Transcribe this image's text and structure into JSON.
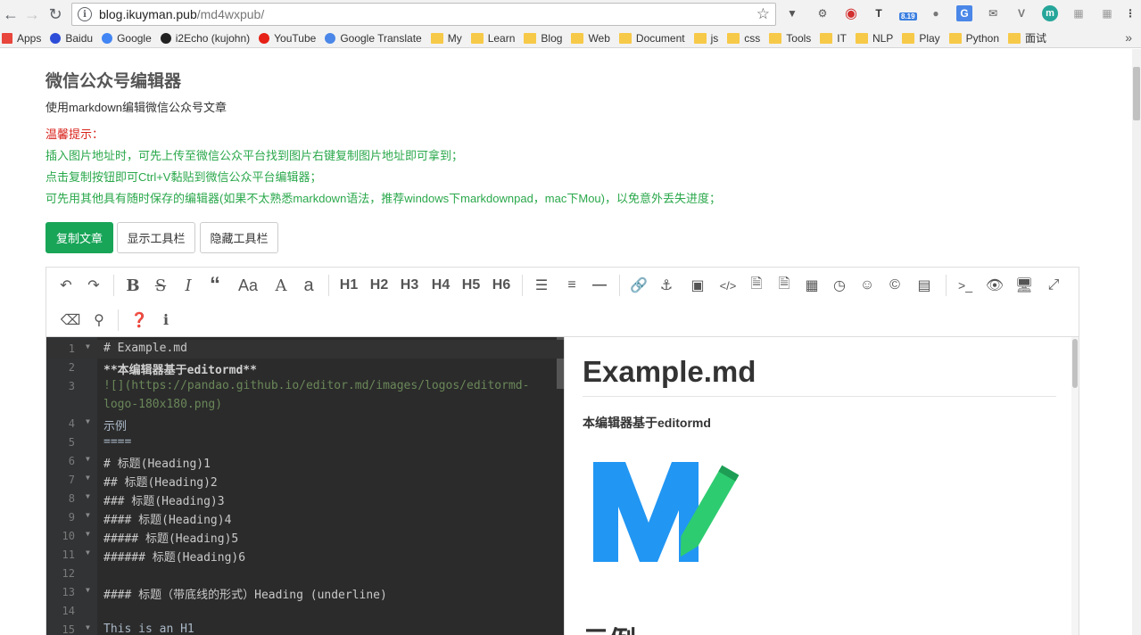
{
  "browser": {
    "url_host": "blog.ikuyman.pub",
    "url_path": "/md4wxpub/",
    "ext_badge": "8.19",
    "bookmarks": [
      {
        "label": "Apps",
        "type": "apps"
      },
      {
        "label": "Baidu",
        "type": "site"
      },
      {
        "label": "Google",
        "type": "site"
      },
      {
        "label": "i2Echo (kujohn)",
        "type": "site"
      },
      {
        "label": "YouTube",
        "type": "site"
      },
      {
        "label": "Google Translate",
        "type": "site"
      },
      {
        "label": "My",
        "type": "folder"
      },
      {
        "label": "Learn",
        "type": "folder"
      },
      {
        "label": "Blog",
        "type": "folder"
      },
      {
        "label": "Web",
        "type": "folder"
      },
      {
        "label": "Document",
        "type": "folder"
      },
      {
        "label": "js",
        "type": "folder"
      },
      {
        "label": "css",
        "type": "folder"
      },
      {
        "label": "Tools",
        "type": "folder"
      },
      {
        "label": "IT",
        "type": "folder"
      },
      {
        "label": "NLP",
        "type": "folder"
      },
      {
        "label": "Play",
        "type": "folder"
      },
      {
        "label": "Python",
        "type": "folder"
      },
      {
        "label": "面试",
        "type": "folder"
      }
    ],
    "more": "»"
  },
  "page": {
    "title": "微信公众号编辑器",
    "subtitle": "使用markdown编辑微信公众号文章",
    "tip_head": "温馨提示：",
    "tips": [
      "插入图片地址时，可先上传至微信公众平台找到图片右键复制图片地址即可拿到；",
      "点击复制按钮即可Ctrl+V黏贴到微信公众平台编辑器；",
      "可先用其他具有随时保存的编辑器(如果不太熟悉markdown语法，推荐windows下markdownpad，mac下Mou)，以免意外丢失进度；"
    ],
    "buttons": {
      "copy": "复制文章",
      "show_toolbar": "显示工具栏",
      "hide_toolbar": "隐藏工具栏"
    }
  },
  "toolbar": {
    "headings": [
      "H1",
      "H2",
      "H3",
      "H4",
      "H5",
      "H6"
    ],
    "aa_upper": "Aa",
    "a_upper": "A",
    "a_lower": "a"
  },
  "code": {
    "lines": [
      {
        "n": "1",
        "fold": true,
        "text": "# Example.md"
      },
      {
        "n": "2",
        "fold": false,
        "text": "**本编辑器基于editormd**"
      },
      {
        "n": "3",
        "fold": false,
        "text": "![](https://pandao.github.io/editor.md/images/logos/editormd-"
      },
      {
        "n": "",
        "fold": false,
        "text": "logo-180x180.png)"
      },
      {
        "n": "4",
        "fold": true,
        "text": "示例"
      },
      {
        "n": "5",
        "fold": false,
        "text": "===="
      },
      {
        "n": "6",
        "fold": true,
        "text": "# 标题(Heading)1"
      },
      {
        "n": "7",
        "fold": true,
        "text": "## 标题(Heading)2"
      },
      {
        "n": "8",
        "fold": true,
        "text": "### 标题(Heading)3"
      },
      {
        "n": "9",
        "fold": true,
        "text": "#### 标题(Heading)4"
      },
      {
        "n": "10",
        "fold": true,
        "text": "##### 标题(Heading)5"
      },
      {
        "n": "11",
        "fold": true,
        "text": "###### 标题(Heading)6"
      },
      {
        "n": "12",
        "fold": false,
        "text": ""
      },
      {
        "n": "13",
        "fold": true,
        "text": "#### 标题（带底线的形式）Heading (underline)"
      },
      {
        "n": "14",
        "fold": false,
        "text": ""
      },
      {
        "n": "15",
        "fold": true,
        "text": "This is an H1"
      }
    ]
  },
  "preview": {
    "h1": "Example.md",
    "bold": "本编辑器基于editormd",
    "h2": "示例",
    "logo_colors": {
      "m": "#2196f3",
      "pencil": "#2ecc71"
    }
  }
}
